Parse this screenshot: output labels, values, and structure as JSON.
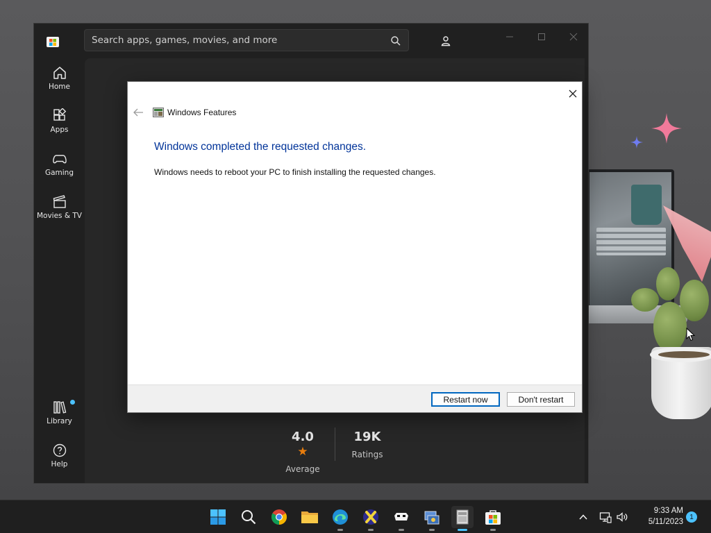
{
  "store": {
    "search_placeholder": "Search apps, games, movies, and more",
    "nav": [
      {
        "label": "Home",
        "icon": "home-icon"
      },
      {
        "label": "Apps",
        "icon": "apps-icon"
      },
      {
        "label": "Gaming",
        "icon": "gamepad-icon"
      },
      {
        "label": "Movies & TV",
        "icon": "clapperboard-icon"
      },
      {
        "label": "Library",
        "icon": "library-icon"
      },
      {
        "label": "Help",
        "icon": "help-icon"
      }
    ],
    "rating": {
      "value": "4.0",
      "label": "Average"
    },
    "ratings_count": {
      "value": "19K",
      "label": "Ratings"
    }
  },
  "dialog": {
    "title": "Windows Features",
    "heading": "Windows completed the requested changes.",
    "message": "Windows needs to reboot your PC to finish installing the requested changes.",
    "primary_button": "Restart now",
    "secondary_button": "Don't restart"
  },
  "taskbar": {
    "apps": [
      "start-icon",
      "search-icon",
      "chrome-icon",
      "file-explorer-icon",
      "edge-icon",
      "xbox-app-icon",
      "game-app-icon",
      "control-panel-icon",
      "windows-features-icon",
      "microsoft-store-icon"
    ],
    "time": "9:33 AM",
    "date": "5/11/2023",
    "notification_count": "1"
  },
  "colors": {
    "dialog_heading": "#003399",
    "accent": "#0067c0",
    "store_background": "#202020",
    "taskbar_background": "#1f1f1f",
    "notification_badge": "#4cc2ff"
  }
}
